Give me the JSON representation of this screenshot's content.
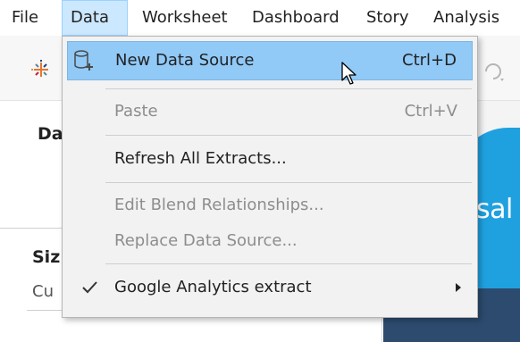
{
  "menubar": {
    "items": [
      {
        "label": "File"
      },
      {
        "label": "Data"
      },
      {
        "label": "Worksheet"
      },
      {
        "label": "Dashboard"
      },
      {
        "label": "Story"
      },
      {
        "label": "Analysis"
      }
    ],
    "active_index": 1
  },
  "toolbar": {
    "logo_icon": "tableau-logo-icon",
    "redo_icon": "redo-icon"
  },
  "left_pane": {
    "data_heading": "Da",
    "size_heading": "Siz",
    "size_field_value": "Cu"
  },
  "canvas": {
    "logo_text": "sal",
    "accent_color": "#1fa1e0"
  },
  "data_menu": {
    "items": [
      {
        "label": "New Data Source",
        "shortcut": "Ctrl+D",
        "state": "highlighted",
        "icon": "new-data-source-icon"
      },
      {
        "label": "Paste",
        "shortcut": "Ctrl+V",
        "state": "disabled"
      },
      {
        "label": "Refresh All Extracts...",
        "state": "enabled"
      },
      {
        "label": "Edit Blend Relationships...",
        "state": "disabled"
      },
      {
        "label": "Replace Data Source...",
        "state": "disabled"
      },
      {
        "label": "Google Analytics extract",
        "state": "checked",
        "has_submenu": true,
        "icon": "checkmark-icon"
      }
    ],
    "highlight_color": "#91c9f7"
  }
}
